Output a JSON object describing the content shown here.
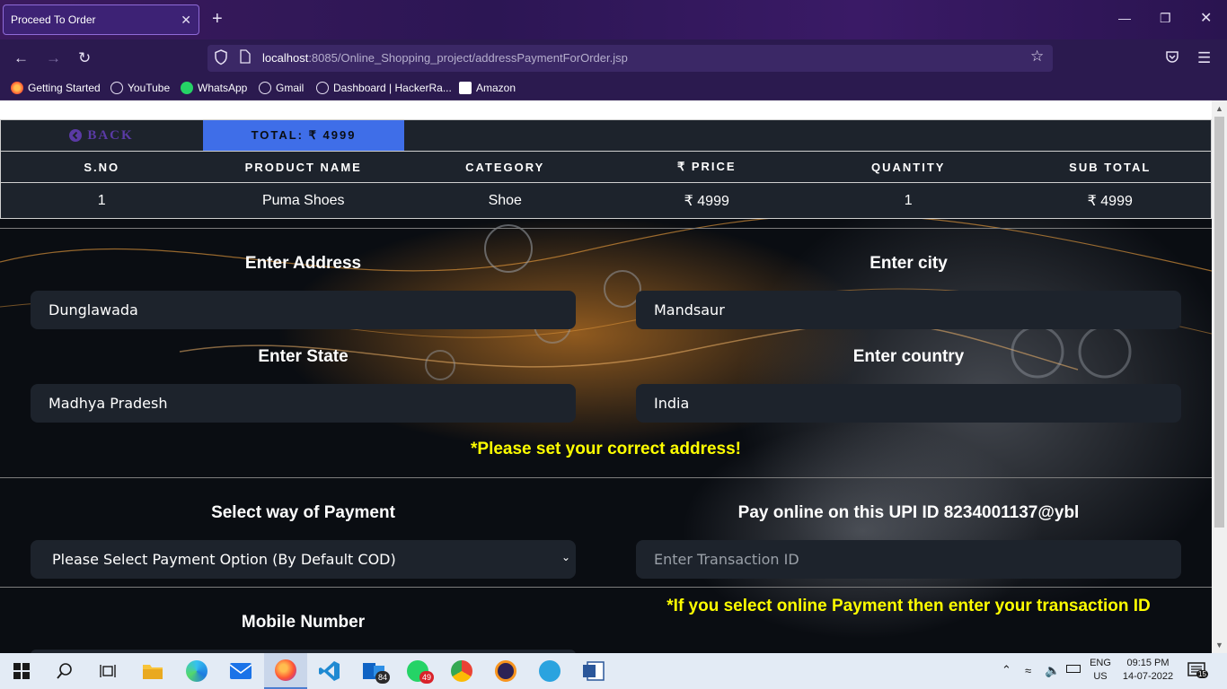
{
  "browser": {
    "tab_title": "Proceed To Order",
    "tab_close": "✕",
    "new_tab": "+",
    "url_host": "localhost",
    "url_rest": ":8085/Online_Shopping_project/addressPaymentForOrder.jsp",
    "bookmarks": [
      "Getting Started",
      "YouTube",
      "WhatsApp",
      "Gmail",
      "Dashboard | HackerRa...",
      "Amazon"
    ]
  },
  "order": {
    "back_label": "BACK",
    "total_label": "TOTAL: ₹ 4999",
    "headers": [
      "S.NO",
      "PRODUCT NAME",
      "CATEGORY",
      "₹ PRICE",
      "QUANTITY",
      "SUB TOTAL"
    ],
    "rows": [
      [
        "1",
        "Puma Shoes",
        "Shoe",
        "₹ 4999",
        "1",
        "₹ 4999"
      ]
    ]
  },
  "address": {
    "address_label": "Enter Address",
    "address_value": "Dunglawada",
    "city_label": "Enter city",
    "city_value": "Mandsaur",
    "state_label": "Enter State",
    "state_value": "Madhya Pradesh",
    "country_label": "Enter country",
    "country_value": "India",
    "notice": "*Please set your correct address!"
  },
  "payment": {
    "method_label": "Select way of Payment",
    "method_selected": "Please Select Payment Option (By Default COD)",
    "upi_label": "Pay online on this UPI ID 8234001137@ybl",
    "transaction_placeholder": "Enter Transaction ID",
    "notice": "*If you select online Payment then enter your transaction ID"
  },
  "mobile": {
    "label": "Mobile Number"
  },
  "taskbar": {
    "badges": {
      "outlook": "84",
      "whatsapp": "49"
    },
    "lang_top": "ENG",
    "lang_bottom": "US",
    "time": "09:15 PM",
    "date": "14-07-2022",
    "notifications": "15"
  },
  "colors": {
    "accent_blue": "#3f6ee8",
    "notice_yellow": "#ffff00",
    "panel_dark": "#1d232c",
    "back_purple": "#5a3aa5"
  }
}
